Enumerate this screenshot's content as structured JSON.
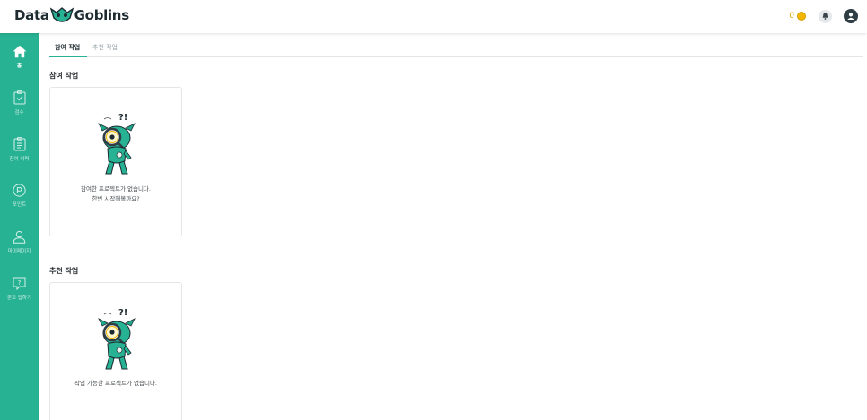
{
  "header": {
    "logo_left": "Data",
    "logo_right": "Goblins",
    "points": "0",
    "colors": {
      "accent": "#27b293",
      "coin": "#f2b705",
      "user": "#2f3d45"
    }
  },
  "sidebar": {
    "items": [
      {
        "label": "홈",
        "icon": "home-icon",
        "active": true
      },
      {
        "label": "검수",
        "icon": "clipboard-check-icon",
        "active": false
      },
      {
        "label": "참여 이력",
        "icon": "clipboard-list-icon",
        "active": false
      },
      {
        "label": "포인트",
        "icon": "point-coin-icon",
        "active": false
      },
      {
        "label": "마이페이지",
        "icon": "user-icon",
        "active": false
      },
      {
        "label": "묻고 답하기",
        "icon": "question-icon",
        "active": false
      }
    ]
  },
  "tabs": [
    {
      "label": "참여 작업",
      "active": true
    },
    {
      "label": "추천 작업",
      "active": false
    }
  ],
  "sections": {
    "participating": {
      "title": "참여 작업",
      "empty_line1": "참여한 프로젝트가 없습니다.",
      "empty_line2": "한번 시작해볼까요?"
    },
    "recommended": {
      "title": "추천 작업",
      "empty_line1": "작업 가능한 프로젝트가 없습니다."
    }
  },
  "illustration": {
    "bubble_text": "?!"
  }
}
